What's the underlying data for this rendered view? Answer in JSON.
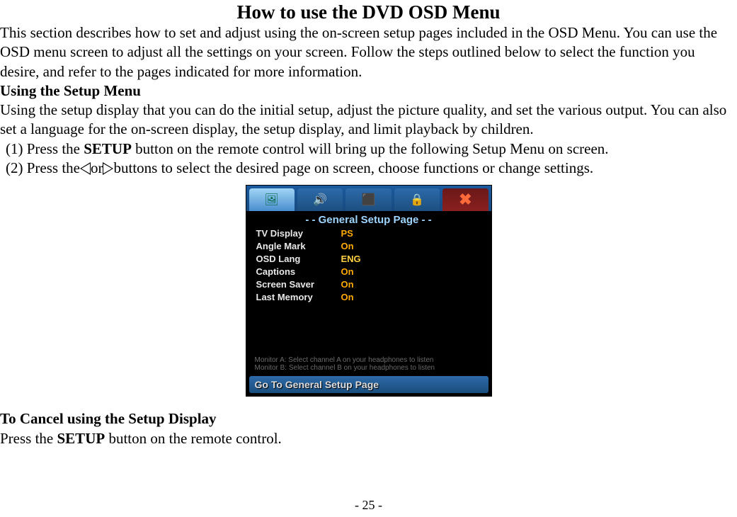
{
  "title": "How to use the DVD OSD Menu",
  "intro": "This section describes how to set and adjust using the on-screen setup pages included in the OSD Menu. You can use the OSD menu screen to adjust all the settings on your screen. Follow the steps outlined below to select the function you desire, and refer to the pages indicated for more information.",
  "sub1_heading": "Using the Setup Menu",
  "sub1_body": "Using the setup display that you can do the initial setup, adjust the picture quality, and set the various output. You can also set a language for the on-screen display, the setup display, and limit playback by children.",
  "step1_pre": "(1) Press the ",
  "step1_bold": "SETUP",
  "step1_post": " button on the remote control will bring up the following Setup Menu on screen.",
  "step2_pre": "(2) Press the",
  "step2_mid": "or",
  "step2_post": "buttons to select the desired page on screen, choose functions or change settings.",
  "osd": {
    "tabs": {
      "t1": "🖼",
      "t2": "🔊",
      "t3": "⬛",
      "t4": "🔒",
      "t5": "✖"
    },
    "header": "- -  General Setup Page  - -",
    "rows": [
      {
        "label": "TV Display",
        "value": "PS"
      },
      {
        "label": "Angle Mark",
        "value": "On"
      },
      {
        "label": "OSD Lang",
        "value": "ENG"
      },
      {
        "label": "Captions",
        "value": "On"
      },
      {
        "label": "Screen Saver",
        "value": "On"
      },
      {
        "label": "Last Memory",
        "value": "On"
      }
    ],
    "hint1": "Monitor A: Select channel A on your headphones to listen",
    "hint2": "Monitor B: Select channel B on your headphones to listen",
    "footer": "Go To General Setup Page"
  },
  "cancel_heading": "To Cancel using the Setup Display",
  "cancel_pre": "Press the ",
  "cancel_bold": "SETUP",
  "cancel_post": " button on the remote control.",
  "page_number": "- 25 -"
}
